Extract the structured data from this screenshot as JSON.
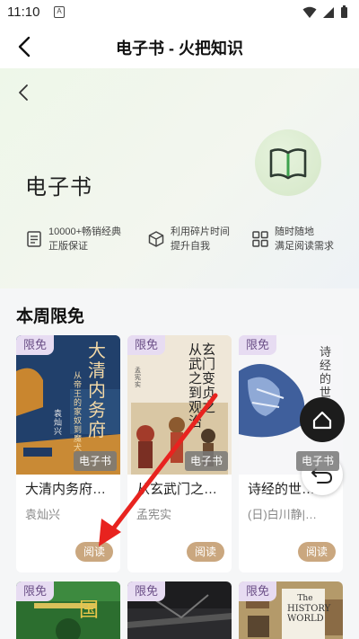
{
  "status": {
    "time": "11:10",
    "a_label": "A"
  },
  "nav": {
    "title": "电子书 - 火把知识"
  },
  "hero": {
    "title": "电子书",
    "features": [
      {
        "line1": "10000+畅销经典",
        "line2": "正版保证",
        "icon": "book-doc-icon"
      },
      {
        "line1": "利用碎片时间",
        "line2": "提升自我",
        "icon": "cube-icon"
      },
      {
        "line1": "随时随地",
        "line2": "满足阅读需求",
        "icon": "grid-icon"
      }
    ]
  },
  "section": {
    "title": "本周限免"
  },
  "books": [
    {
      "free_tag": "限免",
      "cover_title": "大清内务府",
      "cover_subtitle": "从帝王的家奴到魔犬",
      "cover_author": "袁灿兴",
      "ebook_tag": "电子书",
      "title": "大清内务府…",
      "author": "袁灿兴",
      "read": "阅读"
    },
    {
      "free_tag": "限免",
      "cover_title": "从玄武门之变到贞观之治",
      "cover_author": "孟宪实",
      "ebook_tag": "电子书",
      "title": "从玄武门之…",
      "author": "孟宪实",
      "read": "阅读"
    },
    {
      "free_tag": "限免",
      "cover_title": "诗经的世界",
      "ebook_tag": "电子书",
      "title": "诗经的世…",
      "author": "(日)白川静|…",
      "read": "阅读"
    }
  ],
  "books_row2": [
    {
      "free_tag": "限免",
      "cover_text": "国"
    },
    {
      "free_tag": "限免"
    },
    {
      "free_tag": "限免",
      "cover_text1": "The",
      "cover_text2": "HISTORY",
      "cover_text3": "WORLD"
    }
  ],
  "colors": {
    "accent_free": "#e7dcf2",
    "read_button": "#caa77f",
    "arrow": "#e8231f"
  }
}
